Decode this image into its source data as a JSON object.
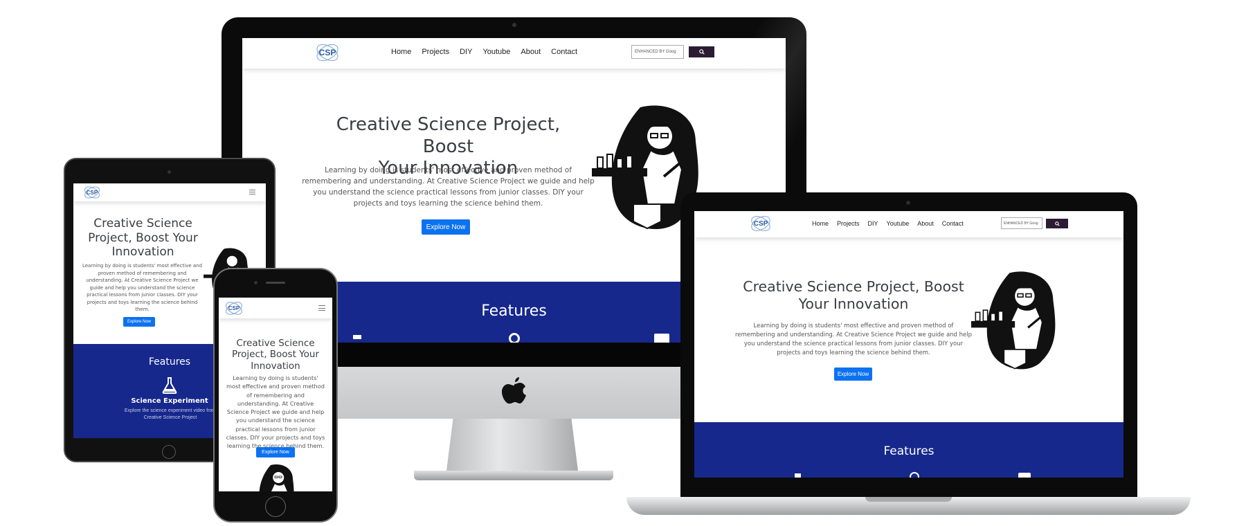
{
  "site": {
    "logo_text": "CSP",
    "nav": [
      "Home",
      "Projects",
      "DIY",
      "Youtube",
      "About",
      "Contact"
    ],
    "search_placeholder": "ENHANCED BY Goog",
    "hero_title": "Creative Science Project, Boost Your Innovation",
    "hero_title_line1": "Creative Science Project, Boost",
    "hero_title_line2": "Your Innovation",
    "hero_text": "Learning by doing is students' most effective and proven method of remembering and understanding. At Creative Science Project we guide and help you understand the science practical lessons from junior classes. DIY your projects and toys learning the science behind them.",
    "hero_text_lines": [
      "Learning by doing is students' most effective and proven method of",
      "remembering and understanding. At Creative Science Project we guide and help",
      "you understand the science practical lessons from junior classes. DIY your",
      "projects and toys learning the science behind them."
    ],
    "cta": "Explore Now",
    "features_title": "Features",
    "feature_1_title": "Science Experiment",
    "feature_1_text": "Explore the science experiment video from Creative Science Project"
  },
  "colors": {
    "features_bg": "#16288c",
    "cta_bg": "#0d72f0",
    "search_btn_bg": "#2b1c33",
    "logo_color": "#2a5a9e"
  },
  "icons": [
    "search-icon",
    "hamburger-icon",
    "flask-icon",
    "apple-logo-icon"
  ]
}
